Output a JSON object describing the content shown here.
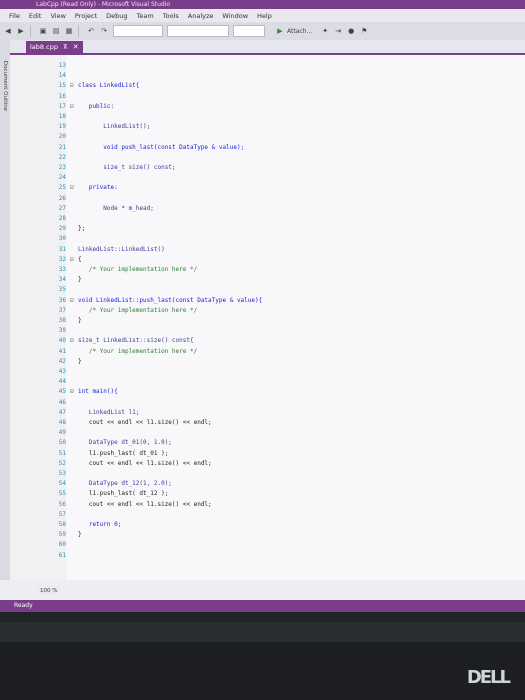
{
  "window": {
    "title": "LabCpp (Read Only) - Microsoft Visual Studio"
  },
  "menu": [
    "File",
    "Edit",
    "View",
    "Project",
    "Debug",
    "Team",
    "Tools",
    "Analyze",
    "Window",
    "Help"
  ],
  "toolbar": {
    "attach_label": "Attach..."
  },
  "sidebar": {
    "label": "Document Outline"
  },
  "tab": {
    "label": "lab8.cpp"
  },
  "code_lines": [
    {
      "num": "13",
      "fold": "",
      "text": ""
    },
    {
      "num": "14",
      "fold": "",
      "text": ""
    },
    {
      "num": "15",
      "fold": "⊟",
      "text": "class LinkedList{"
    },
    {
      "num": "16",
      "fold": "",
      "text": ""
    },
    {
      "num": "17",
      "fold": "⊟",
      "text": "   public:"
    },
    {
      "num": "18",
      "fold": "",
      "text": ""
    },
    {
      "num": "19",
      "fold": "",
      "text": "       LinkedList();"
    },
    {
      "num": "20",
      "fold": "",
      "text": ""
    },
    {
      "num": "21",
      "fold": "",
      "text": "       void push_last(const DataType & value);"
    },
    {
      "num": "22",
      "fold": "",
      "text": ""
    },
    {
      "num": "23",
      "fold": "",
      "text": "       size_t size() const;"
    },
    {
      "num": "24",
      "fold": "",
      "text": ""
    },
    {
      "num": "25",
      "fold": "⊟",
      "text": "   private:"
    },
    {
      "num": "26",
      "fold": "",
      "text": ""
    },
    {
      "num": "27",
      "fold": "",
      "text": "       Node * m_head;"
    },
    {
      "num": "28",
      "fold": "",
      "text": ""
    },
    {
      "num": "29",
      "fold": "",
      "text": "};"
    },
    {
      "num": "30",
      "fold": "",
      "text": ""
    },
    {
      "num": "31",
      "fold": "",
      "text": "LinkedList::LinkedList()"
    },
    {
      "num": "32",
      "fold": "⊟",
      "text": "{"
    },
    {
      "num": "33",
      "fold": "",
      "text": "   /* Your implementation here */"
    },
    {
      "num": "34",
      "fold": "",
      "text": "}"
    },
    {
      "num": "35",
      "fold": "",
      "text": ""
    },
    {
      "num": "36",
      "fold": "⊟",
      "text": "void LinkedList::push_last(const DataType & value){"
    },
    {
      "num": "37",
      "fold": "",
      "text": "   /* Your implementation here */"
    },
    {
      "num": "38",
      "fold": "",
      "text": "}"
    },
    {
      "num": "39",
      "fold": "",
      "text": ""
    },
    {
      "num": "40",
      "fold": "⊟",
      "text": "size_t LinkedList::size() const{"
    },
    {
      "num": "41",
      "fold": "",
      "text": "   /* Your implementation here */"
    },
    {
      "num": "42",
      "fold": "",
      "text": "}"
    },
    {
      "num": "43",
      "fold": "",
      "text": ""
    },
    {
      "num": "44",
      "fold": "",
      "text": ""
    },
    {
      "num": "45",
      "fold": "⊟",
      "text": "int main(){"
    },
    {
      "num": "46",
      "fold": "",
      "text": ""
    },
    {
      "num": "47",
      "fold": "",
      "text": "   LinkedList l1;"
    },
    {
      "num": "48",
      "fold": "",
      "text": "   cout << endl << l1.size() << endl;"
    },
    {
      "num": "49",
      "fold": "",
      "text": ""
    },
    {
      "num": "50",
      "fold": "",
      "text": "   DataType dt_01(0, 1.0);"
    },
    {
      "num": "51",
      "fold": "",
      "text": "   l1.push_last( dt_01 );"
    },
    {
      "num": "52",
      "fold": "",
      "text": "   cout << endl << l1.size() << endl;"
    },
    {
      "num": "53",
      "fold": "",
      "text": ""
    },
    {
      "num": "54",
      "fold": "",
      "text": "   DataType dt_12(1, 2.0);"
    },
    {
      "num": "55",
      "fold": "",
      "text": "   l1.push_last( dt_12 );"
    },
    {
      "num": "56",
      "fold": "",
      "text": "   cout << endl << l1.size() << endl;"
    },
    {
      "num": "57",
      "fold": "",
      "text": ""
    },
    {
      "num": "58",
      "fold": "",
      "text": "   return 0;"
    },
    {
      "num": "59",
      "fold": "",
      "text": "}"
    },
    {
      "num": "60",
      "fold": "",
      "text": ""
    },
    {
      "num": "61",
      "fold": "",
      "text": ""
    }
  ],
  "zoom": "100 %",
  "status": {
    "text": "Ready"
  },
  "monitor": {
    "brand": "DELL"
  },
  "colors": {
    "accent": "#7a3d8a",
    "keyword": "#1a1adc",
    "type": "#2b91af",
    "comment": "#2e7d32",
    "linenum": "#2b91af"
  }
}
